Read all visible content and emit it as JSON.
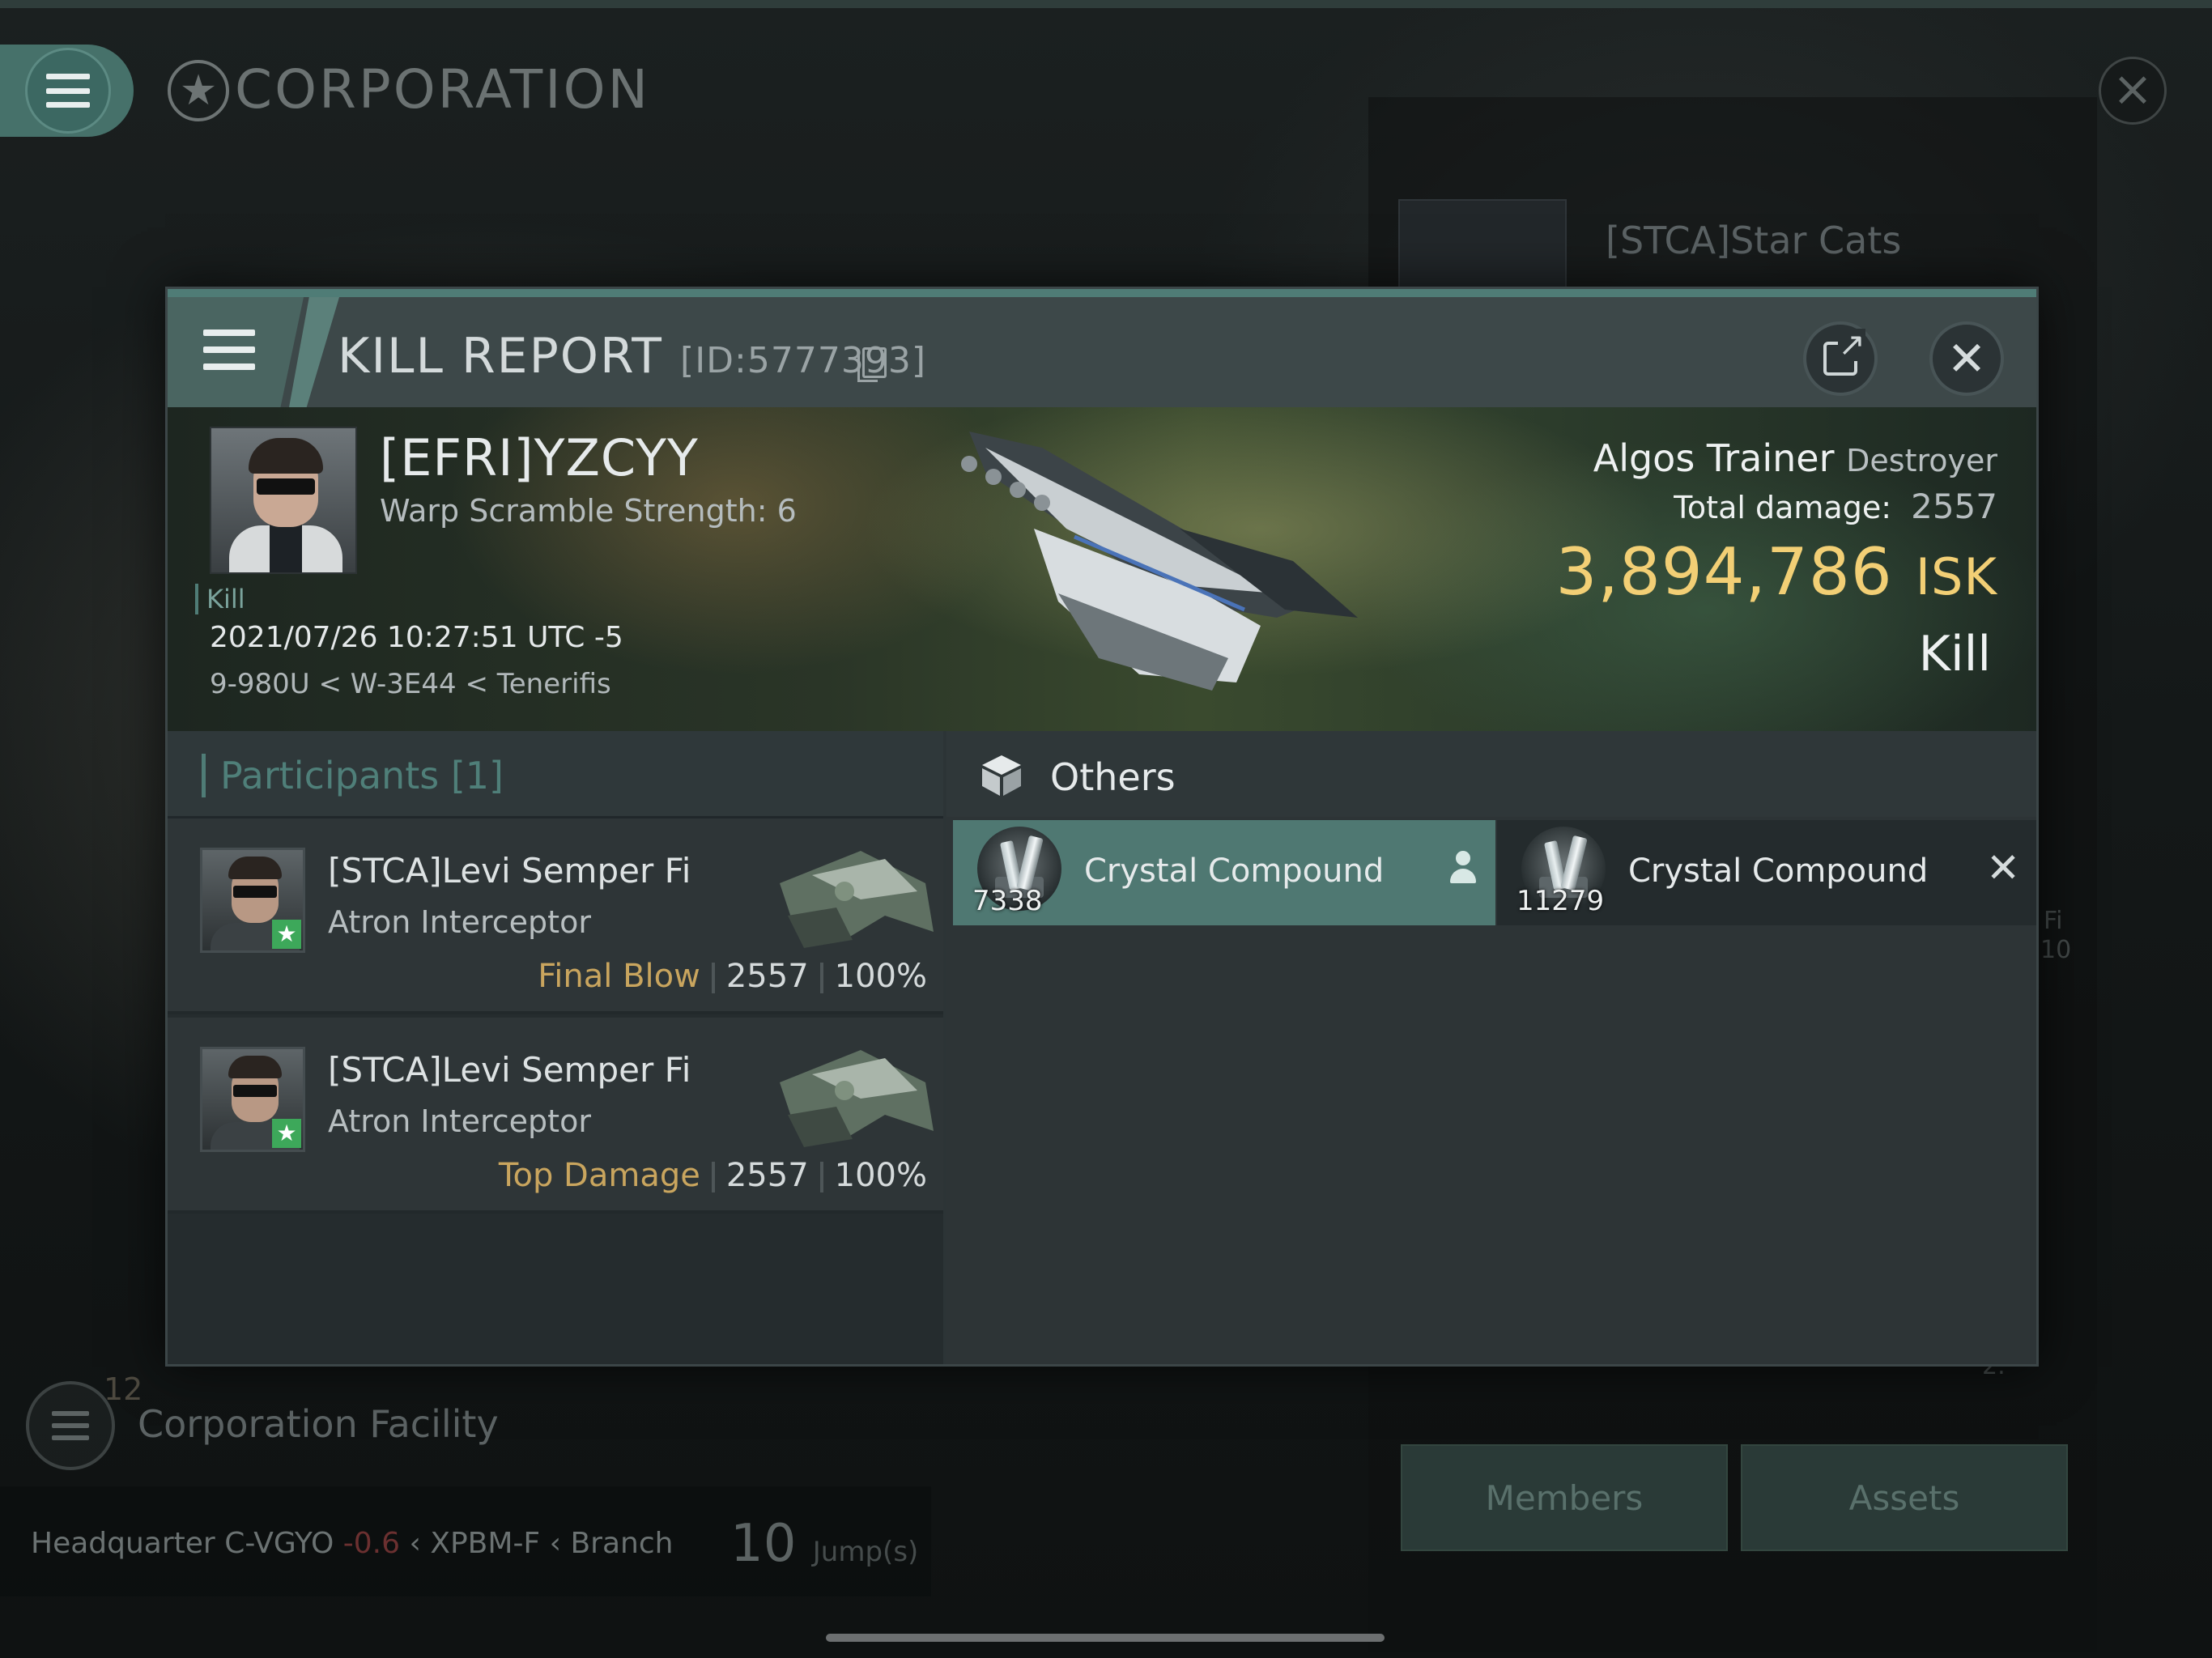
{
  "background": {
    "screen_title": "CORPORATION",
    "corp_name": "[STCA]Star Cats",
    "facility_label": "Corporation Facility",
    "facility_number": "12",
    "hq": {
      "label": "Headquarter",
      "system": "C-VGYO",
      "security": "-0.6",
      "region": "XPBM-F",
      "branch": "Branch",
      "jumps": "10",
      "jumps_unit": "Jump(s)"
    },
    "side_numbers": [
      "Fi",
      "10",
      "2."
    ],
    "buttons": [
      "Members",
      "Assets"
    ]
  },
  "dialog": {
    "title": "KILL REPORT",
    "id": "[ID:5777393]",
    "victim": {
      "name": "[EFRI]YZCYY",
      "warp": "Warp Scramble Strength: 6",
      "tag": "Kill",
      "date": "2021/07/26 10:27:51 UTC -5",
      "location": "9-980U < W-3E44 < Tenerifis",
      "ship": "Algos Trainer",
      "ship_class": "Destroyer",
      "total_damage_label": "Total damage:",
      "total_damage": "2557",
      "isk_value": "3,894,786",
      "isk_unit": "ISK",
      "result": "Kill"
    },
    "participants": {
      "title": "Participants",
      "count": "[1]",
      "rows": [
        {
          "name": "[STCA]Levi Semper Fi",
          "ship": "Atron Interceptor",
          "label": "Final Blow",
          "damage": "2557",
          "percent": "100%"
        },
        {
          "name": "[STCA]Levi Semper Fi",
          "ship": "Atron Interceptor",
          "label": "Top Damage",
          "damage": "2557",
          "percent": "100%"
        }
      ]
    },
    "others": {
      "title": "Others",
      "items": [
        {
          "name": "Crystal Compound",
          "qty": "7338"
        },
        {
          "name": "Crystal Compound",
          "qty": "11279"
        }
      ]
    }
  },
  "colors": {
    "accent": "#4f7c76",
    "isk": "#f2cf75",
    "label_gold": "#c9a55e"
  },
  "icons": [
    "menu-icon",
    "star-icon",
    "close-icon",
    "copy-icon",
    "share-icon",
    "cube-icon",
    "person-icon"
  ]
}
